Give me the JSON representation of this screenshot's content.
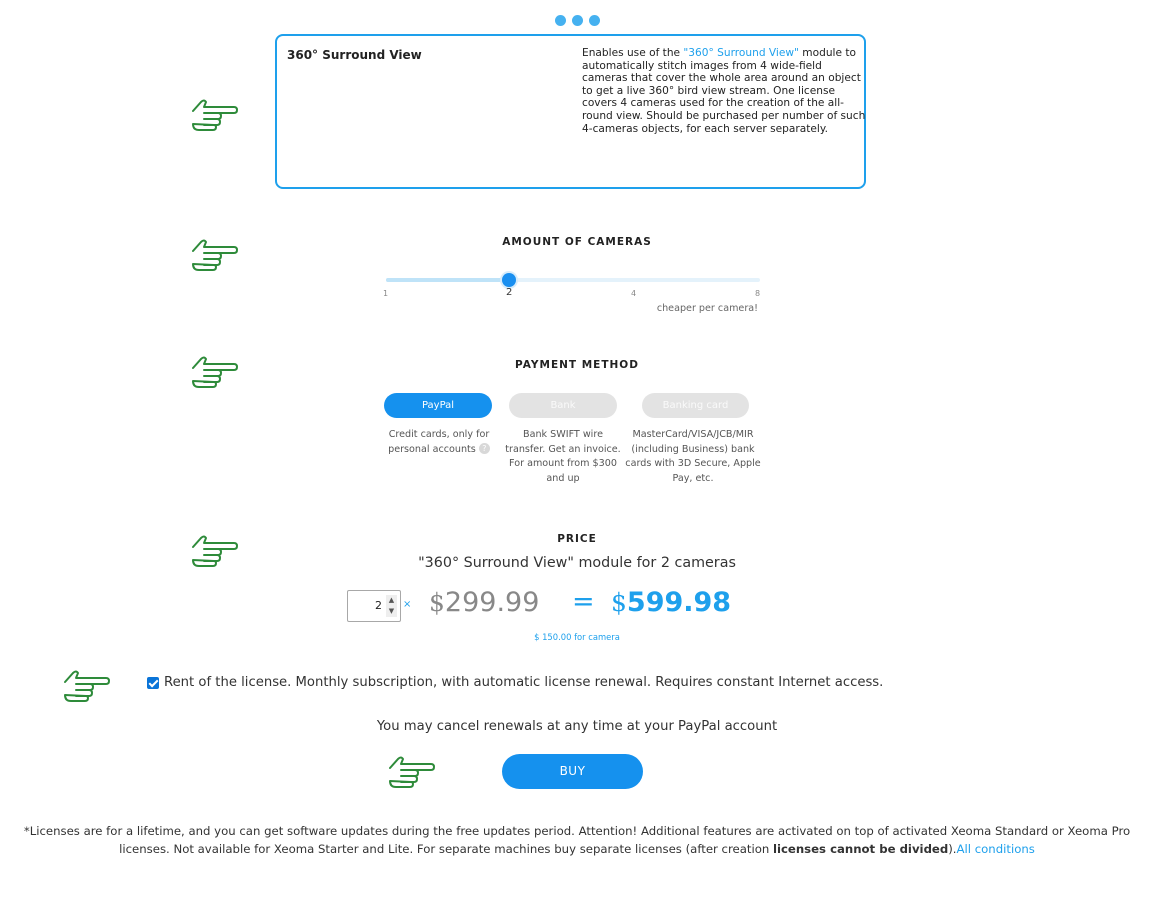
{
  "carousel": {
    "dot_count": 3,
    "dot_color": "#45b1f0"
  },
  "module": {
    "title": "360° Surround View",
    "desc_prefix": "Enables use of the ",
    "desc_link": "\"360° Surround View\"",
    "desc_suffix": " module to automatically stitch images from 4 wide-field cameras that cover the whole area around an object to get a live 360° bird view stream. One license covers 4 cameras used for the creation of the all-round view. Should be purchased per number of such 4-cameras objects, for each server separately."
  },
  "cameras": {
    "heading": "AMOUNT OF CAMERAS",
    "ticks": [
      "1",
      "2",
      "4",
      "8"
    ],
    "selected": "2",
    "note": "cheaper per camera!"
  },
  "payment": {
    "heading": "PAYMENT METHOD",
    "methods": [
      {
        "label": "PayPal",
        "desc_line1": "Credit cards, only for",
        "desc_line2": "personal accounts",
        "selected": true
      },
      {
        "label": "Bank",
        "desc": "Bank SWIFT wire transfer. Get an invoice. For amount from $300 and up",
        "selected": false
      },
      {
        "label": "Banking card",
        "desc": "MasterCard/VISA/JCB/MIR (including Business) bank cards with 3D Secure, Apple Pay, etc.",
        "selected": false
      }
    ],
    "help_symbol": "?"
  },
  "price": {
    "heading": "PRICE",
    "subtitle": "\"360° Surround View\" module for 2 cameras",
    "quantity": "2",
    "times_symbol": "×",
    "currency": "$",
    "unit_price": "299.99",
    "equals": "=",
    "total": "599.98",
    "per_camera": "$ 150.00 for camera"
  },
  "rent": {
    "checked": true,
    "label": "Rent of the license. Monthly subscription, with automatic license renewal. Requires constant Internet access."
  },
  "cancel_note": "You may cancel renewals at any time at your PayPal account",
  "buy_label": "BUY",
  "footnote": {
    "text": "*Licenses are for a lifetime, and you can get software updates during the free updates period. Attention! Additional features are activated on top of activated Xeoma Standard or Xeoma Pro licenses. Not available for Xeoma Starter and Lite. For separate machines buy separate licenses (after creation ",
    "bold": "licenses cannot be divided",
    "after_bold": ").",
    "link": "All conditions"
  },
  "colors": {
    "accent": "#1ea0ec",
    "button": "#1591ee",
    "hand_icon": "#2e8b3a",
    "disabled": "#e3e3e3"
  },
  "icons": [
    "pointing-hand-icon",
    "checkbox-checked-icon",
    "spinner-arrows-icon"
  ]
}
